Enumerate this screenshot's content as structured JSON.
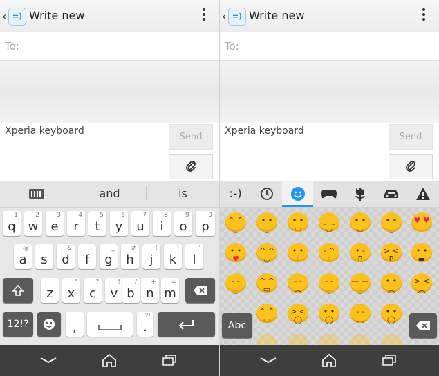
{
  "left": {
    "title": "Write new",
    "to_label": "To:",
    "message_placeholder": "Xperia keyboard",
    "send_label": "Send",
    "suggestions": [
      "",
      "and",
      "is"
    ],
    "rows": [
      [
        {
          "m": "q",
          "h": "1"
        },
        {
          "m": "w",
          "h": "2"
        },
        {
          "m": "e",
          "h": "3"
        },
        {
          "m": "r",
          "h": "4"
        },
        {
          "m": "t",
          "h": "5"
        },
        {
          "m": "y",
          "h": "6"
        },
        {
          "m": "u",
          "h": "7"
        },
        {
          "m": "i",
          "h": "8"
        },
        {
          "m": "o",
          "h": "9"
        },
        {
          "m": "p",
          "h": "0"
        }
      ],
      [
        {
          "m": "a",
          "h": "@"
        },
        {
          "m": "s",
          "h": ""
        },
        {
          "m": "d",
          "h": "&"
        },
        {
          "m": "f",
          "h": "-"
        },
        {
          "m": "g",
          "h": "_"
        },
        {
          "m": "h",
          "h": "#"
        },
        {
          "m": "j",
          "h": "("
        },
        {
          "m": "k",
          "h": ")"
        },
        {
          "m": "l",
          "h": "'"
        }
      ],
      [
        {
          "m": "z",
          "h": ""
        },
        {
          "m": "x",
          "h": "\""
        },
        {
          "m": "c",
          "h": "?"
        },
        {
          "m": "v",
          "h": "!"
        },
        {
          "m": "b",
          "h": "/"
        },
        {
          "m": "n",
          "h": "+"
        },
        {
          "m": "m",
          "h": "="
        }
      ]
    ],
    "symbols_key": "12!?",
    "comma_key": ",",
    "period_key": ".",
    "period_hint": "?!"
  },
  "right": {
    "title": "Write new",
    "to_label": "To:",
    "message_placeholder": "Xperia keyboard",
    "send_label": "Send",
    "emoticon_tab": ":-)",
    "abc_key": "Abc"
  },
  "icons": {
    "back": "back-chevron-icon",
    "app": "messaging-app-icon",
    "menu": "overflow-menu-icon",
    "attach": "paperclip-icon",
    "shift": "shift-icon",
    "backspace": "backspace-icon",
    "emoji": "emoji-icon",
    "enter": "enter-icon",
    "nav_back": "nav-back-icon",
    "nav_home": "nav-home-icon",
    "nav_recent": "nav-recent-apps-icon"
  },
  "colors": {
    "accent": "#2196f3",
    "emoji_yellow": "#fcc21b",
    "dark_key": "#5a5a5a",
    "navbar": "#3e3e3e"
  }
}
